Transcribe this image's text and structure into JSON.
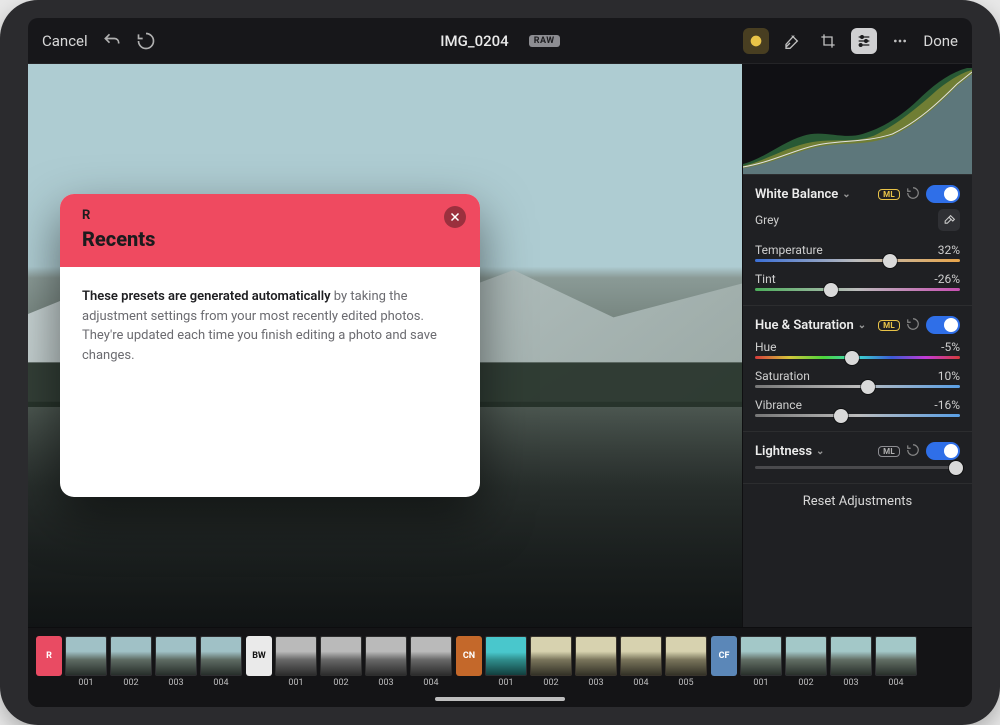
{
  "toolbar": {
    "cancel": "Cancel",
    "filename": "IMG_0204",
    "raw_badge": "RAW",
    "done": "Done"
  },
  "modal": {
    "letter": "R",
    "title": "Recents",
    "body_bold": "These presets are generated automatically",
    "body_rest": " by taking the adjustment settings from your most recently edited photos. They're updated each time you finish editing a photo and save changes."
  },
  "inspector": {
    "wb": {
      "title": "White Balance",
      "mode_label": "Grey",
      "temperature_label": "Temperature",
      "temperature_value": "32%",
      "tint_label": "Tint",
      "tint_value": "-26%"
    },
    "hs": {
      "title": "Hue & Saturation",
      "hue_label": "Hue",
      "hue_value": "-5%",
      "sat_label": "Saturation",
      "sat_value": "10%",
      "vib_label": "Vibrance",
      "vib_value": "-16%"
    },
    "lightness": {
      "title": "Lightness"
    },
    "reset": "Reset Adjustments",
    "ml_badge": "ML"
  },
  "filmstrip": {
    "tags": {
      "r": "R",
      "bw": "BW",
      "cn": "CN",
      "cf": "CF"
    },
    "groups": [
      {
        "key": "r",
        "labels": [
          "001",
          "002",
          "003",
          "004"
        ]
      },
      {
        "key": "bw",
        "labels": [
          "001",
          "002",
          "003",
          "004"
        ]
      },
      {
        "key": "cn",
        "labels": [
          "001",
          "002",
          "003",
          "004",
          "005"
        ]
      },
      {
        "key": "cf",
        "labels": [
          "001",
          "002",
          "003",
          "004"
        ]
      }
    ]
  }
}
